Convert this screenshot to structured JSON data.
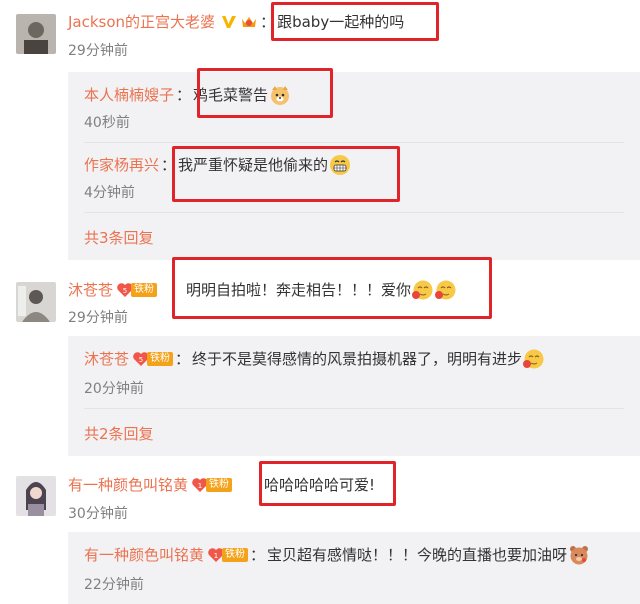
{
  "comments": [
    {
      "username": "Jackson的正宫大老婆",
      "text": "跟baby一起种的吗",
      "time": "29分钟前",
      "replies": [
        {
          "username": "本人楠楠嫂子",
          "text": "鸡毛菜警告",
          "time": "40秒前"
        },
        {
          "username": "作家杨再兴",
          "text": "我严重怀疑是他偷来的",
          "time": "4分钟前"
        }
      ],
      "more_replies": "共3条回复"
    },
    {
      "username": "沐苍苍",
      "fan_label": "铁粉",
      "text": "明明自拍啦！奔走相告！！！爱你",
      "time": "29分钟前",
      "replies": [
        {
          "username": "沐苍苍",
          "fan_label": "铁粉",
          "text": "终于不是莫得感情的风景拍摄机器了，明明有进步",
          "time": "20分钟前"
        }
      ],
      "more_replies": "共2条回复"
    },
    {
      "username": "有一种颜色叫铭黄",
      "fan_label": "铁粉",
      "text": "哈哈哈哈哈可爱!",
      "time": "30分钟前",
      "replies": [
        {
          "username": "有一种颜色叫铭黄",
          "fan_label": "铁粉",
          "text": "宝贝超有感情哒！！！今晚的直播也要加油呀",
          "time": "22分钟前"
        }
      ]
    }
  ],
  "colors": {
    "username": "#eb7350",
    "highlight": "#e0242a",
    "fan_badge": "#f4a21a",
    "reply_bg": "#f2f2f5"
  },
  "icons": [
    "verified-v-icon",
    "crown-badge-icon",
    "fan-heart-icon",
    "doge-emoji-icon",
    "grin-emoji-icon",
    "blush-emoji-icon"
  ]
}
